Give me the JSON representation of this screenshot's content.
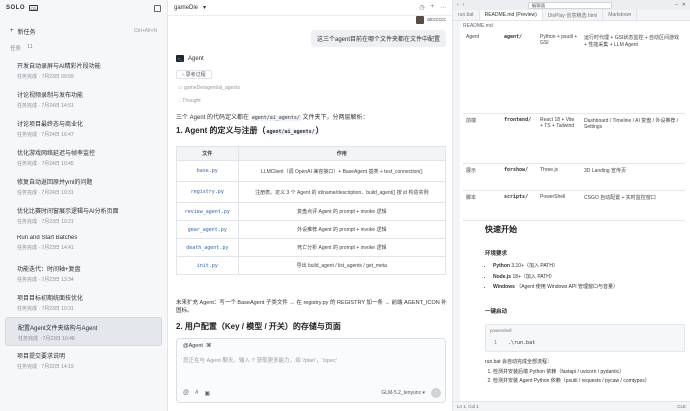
{
  "sidebar": {
    "logo": "SOLO",
    "logo_badge": "CD",
    "new_task_label": "新任务",
    "new_task_shortcut": "Ctrl+Alt+N",
    "tasks_header": "任务",
    "tasks_count": "11",
    "tasks": [
      {
        "title": "开发自动录屏与AI精彩片段功能",
        "meta": "任务完成 · 7月23日 09:59"
      },
      {
        "title": "讨论视频录制与发布功能",
        "meta": "任务完成 · 7月24日 14:51"
      },
      {
        "title": "讨论项目最终态与商业化",
        "meta": "任务完成 · 7月24日 16:47"
      },
      {
        "title": "优化游戏网络延迟与帧率监控",
        "meta": "任务完成 · 7月24日 10:45"
      },
      {
        "title": "修复自动返回原并yml的问题",
        "meta": "任务完成 · 7月24日 10:31"
      },
      {
        "title": "优化比赛时间窗展示逻辑与AI分析页面",
        "meta": "任务完成 · 7月23日 10:21"
      },
      {
        "title": "Run and Start Batches",
        "meta": "任务完成 · 7月23日 14:41"
      },
      {
        "title": "功能迭代：时间轴+复盘",
        "meta": "任务完成 · 7月23日 13:34"
      },
      {
        "title": "项目目标初期统面技优化",
        "meta": "任务完成 · 7月23日 10:31"
      },
      {
        "title": "配置Agent文件夹结构与Agent",
        "meta": "任务完成 · 7月23日 10:48",
        "active": true
      },
      {
        "title": "项目提交要求说明",
        "meta": "任务完成 · 7月22日 14:19"
      }
    ]
  },
  "chat": {
    "title": "gameDle",
    "user_name": "aicccccc",
    "user_message": "这三个agent目前在哪个文件夹都在文件中配置",
    "agent_name": "Agent",
    "pill_label": "思考过程",
    "subpath": "gameDe/agent/ai_agents",
    "thought_label": "Thought",
    "intro_text": "三个 Agent 的代码定义都在",
    "intro_code": "agent/ai_agents/",
    "intro_tail": "文件夹下，分两层解析：",
    "section1_title": "1. Agent 的定义与注册（",
    "section1_code": "agent/ai_agents/",
    "section1_close": "）",
    "table_headers": [
      "文件",
      "作用"
    ],
    "table_rows": [
      {
        "file": "base.py",
        "desc": "LLMClient（调 OpenAI 兼容接口）+ BaseAgent 基类 + test_connection()"
      },
      {
        "file": "registry.py",
        "desc": "注册表。定义 3 个 Agent 的 id/name/description、build_agent() 按 id 构造实例"
      },
      {
        "file": "review_agent.py",
        "desc": "复盘点评 Agent 的 prompt + invoke 逻辑"
      },
      {
        "file": "gear_agent.py",
        "desc": "外设推荐 Agent 的 prompt + invoke 逻辑"
      },
      {
        "file": "death_agent.py",
        "desc": "死亡分析 Agent 的 prompt + invoke 逻辑"
      },
      {
        "file": "init.py",
        "desc": "导出 build_agent / list_agents / get_meta"
      }
    ],
    "extend_text": "未来扩充 Agent：写一个 BaseAgent 子类文件 → 在 registry.py 的 REGISTRY 加一条 → 前端 AGENT_ICON 补图标。",
    "section2_title": "2. 用户配置（Key / 模型 / 开关）的存储与页面",
    "composer_tag": "@Agent",
    "composer_placeholder": "您正在与 Agent 聊天。输入 '/' 获取更多能力，如 '/plan'，'/spec'",
    "model_label": "GLM-5.2_tenyunc"
  },
  "editor": {
    "title_search": "编辑器",
    "tabs": [
      "run.bat",
      "README.md (Preview)",
      "DixPlay·创意精选.html",
      "Markdown"
    ],
    "active_tab": 1,
    "breadcrumb": "README.md",
    "stack_rows": [
      {
        "layer": "Agent",
        "dir": "agent/",
        "tech": "Python + psutil + GSI",
        "desc": "运行时代理 + GSI状态监控 + 自动区间游戏 + 性能采集 + LLM Agent"
      },
      {
        "layer": "前端",
        "dir": "frontend/",
        "tech": "React 18 + Vite + TS + Tailwind",
        "desc": "Dashboard / Timeline / AI 复盘 / 外设推荐 / Settings"
      },
      {
        "layer": "展示",
        "dir": "forshow/",
        "tech": "Three.js",
        "desc": "3D Landing 宣传页"
      },
      {
        "layer": "脚本",
        "dir": "scripts/",
        "tech": "PowerShell",
        "desc": "CSGO 自动配置 + 实时监控窗口"
      }
    ],
    "quickstart_title": "快速开始",
    "env_title": "环境要求",
    "env_items": [
      {
        "bold": "Python",
        "text": "3.10+（加入 PATH）"
      },
      {
        "bold": "Node.js",
        "text": "18+（加入 PATH）"
      },
      {
        "bold": "Windows",
        "text": "（Agent 使用 Windows API 管理窗口与音量）"
      }
    ],
    "oneclick_title": "一键启动",
    "code_lang": "powershell",
    "code_line_no": "1",
    "code_cmd": ".\\run.bat",
    "flow_text": "run.bat 会自动完成全部流程：",
    "steps": [
      "检测并安装后端 Python 依赖（fastapi / uvicorn / pydantic）",
      "检测并安装 Agent Python 依赖（psutil / requests / pycaw / comtypes）"
    ],
    "status_left": "Ln 1, Col 1",
    "status_right": "CLE"
  }
}
